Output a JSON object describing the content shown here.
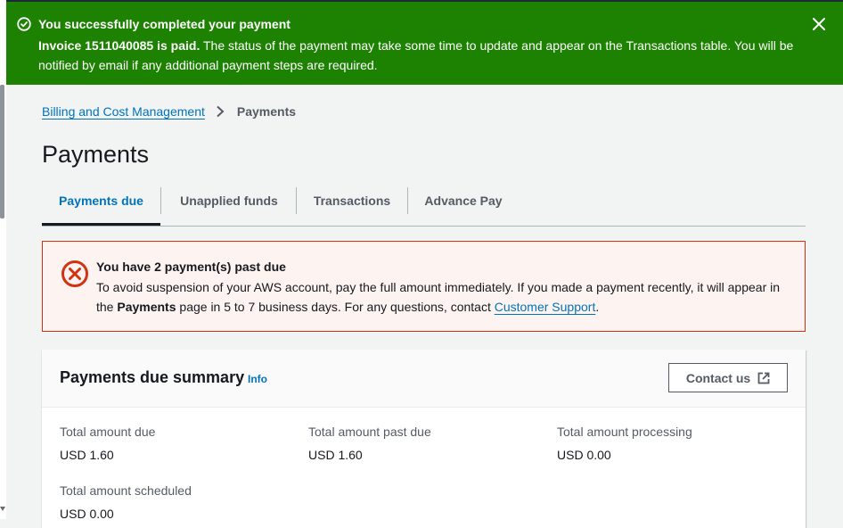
{
  "flash": {
    "title": "You successfully completed your payment",
    "body_bold": "Invoice 1511040085 is paid.",
    "body_text": " The status of the payment may take some time to update and appear on the Transactions table. You will be notified by email if any additional payment steps are required.",
    "color": "#1d8102"
  },
  "breadcrumb": {
    "parent": "Billing and Cost Management",
    "current": "Payments"
  },
  "page": {
    "title": "Payments"
  },
  "tabs": [
    {
      "label": "Payments due",
      "active": true
    },
    {
      "label": "Unapplied funds"
    },
    {
      "label": "Transactions"
    },
    {
      "label": "Advance Pay"
    }
  ],
  "alert": {
    "title": "You have 2 payment(s) past due",
    "text_1": "To avoid suspension of your AWS account, pay the full amount immediately. If you made a payment recently, it will appear in the ",
    "text_bold": "Payments",
    "text_2": " page in 5 to 7 business days. For any questions, contact ",
    "link": "Customer Support",
    "text_end": ".",
    "color": "#d13212"
  },
  "summary": {
    "title": "Payments due summary",
    "info": "Info",
    "contact_button": "Contact us",
    "stats": [
      {
        "label": "Total amount due",
        "value": "USD 1.60"
      },
      {
        "label": "Total amount past due",
        "value": "USD 1.60"
      },
      {
        "label": "Total amount processing",
        "value": "USD 0.00"
      },
      {
        "label": "Total amount scheduled",
        "value": "USD 0.00"
      }
    ]
  },
  "colors": {
    "link": "#0073bb",
    "background": "#f2f3f3"
  }
}
